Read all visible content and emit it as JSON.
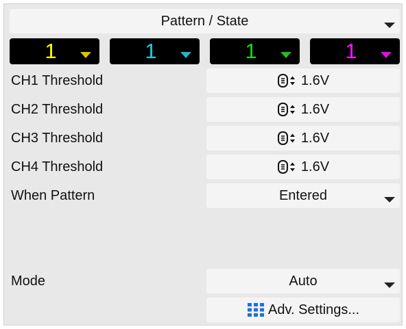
{
  "trigger_type": {
    "selected": "Pattern / State"
  },
  "channels": [
    {
      "value": "1",
      "color": "#ffff00"
    },
    {
      "value": "1",
      "color": "#22cbd6"
    },
    {
      "value": "1",
      "color": "#20d020"
    },
    {
      "value": "1",
      "color": "#ff14ff"
    }
  ],
  "thresholds": [
    {
      "label": "CH1 Threshold",
      "value": "1.6V"
    },
    {
      "label": "CH2 Threshold",
      "value": "1.6V"
    },
    {
      "label": "CH3 Threshold",
      "value": "1.6V"
    },
    {
      "label": "CH4 Threshold",
      "value": "1.6V"
    }
  ],
  "when_pattern": {
    "label": "When Pattern",
    "selected": "Entered"
  },
  "mode": {
    "label": "Mode",
    "selected": "Auto"
  },
  "adv_settings": {
    "label": "Adv. Settings..."
  },
  "icons": {
    "threshold_control": "knob-updown-icon",
    "dropdown": "chevron-down-icon",
    "adv_settings": "keypad-grid-icon"
  }
}
